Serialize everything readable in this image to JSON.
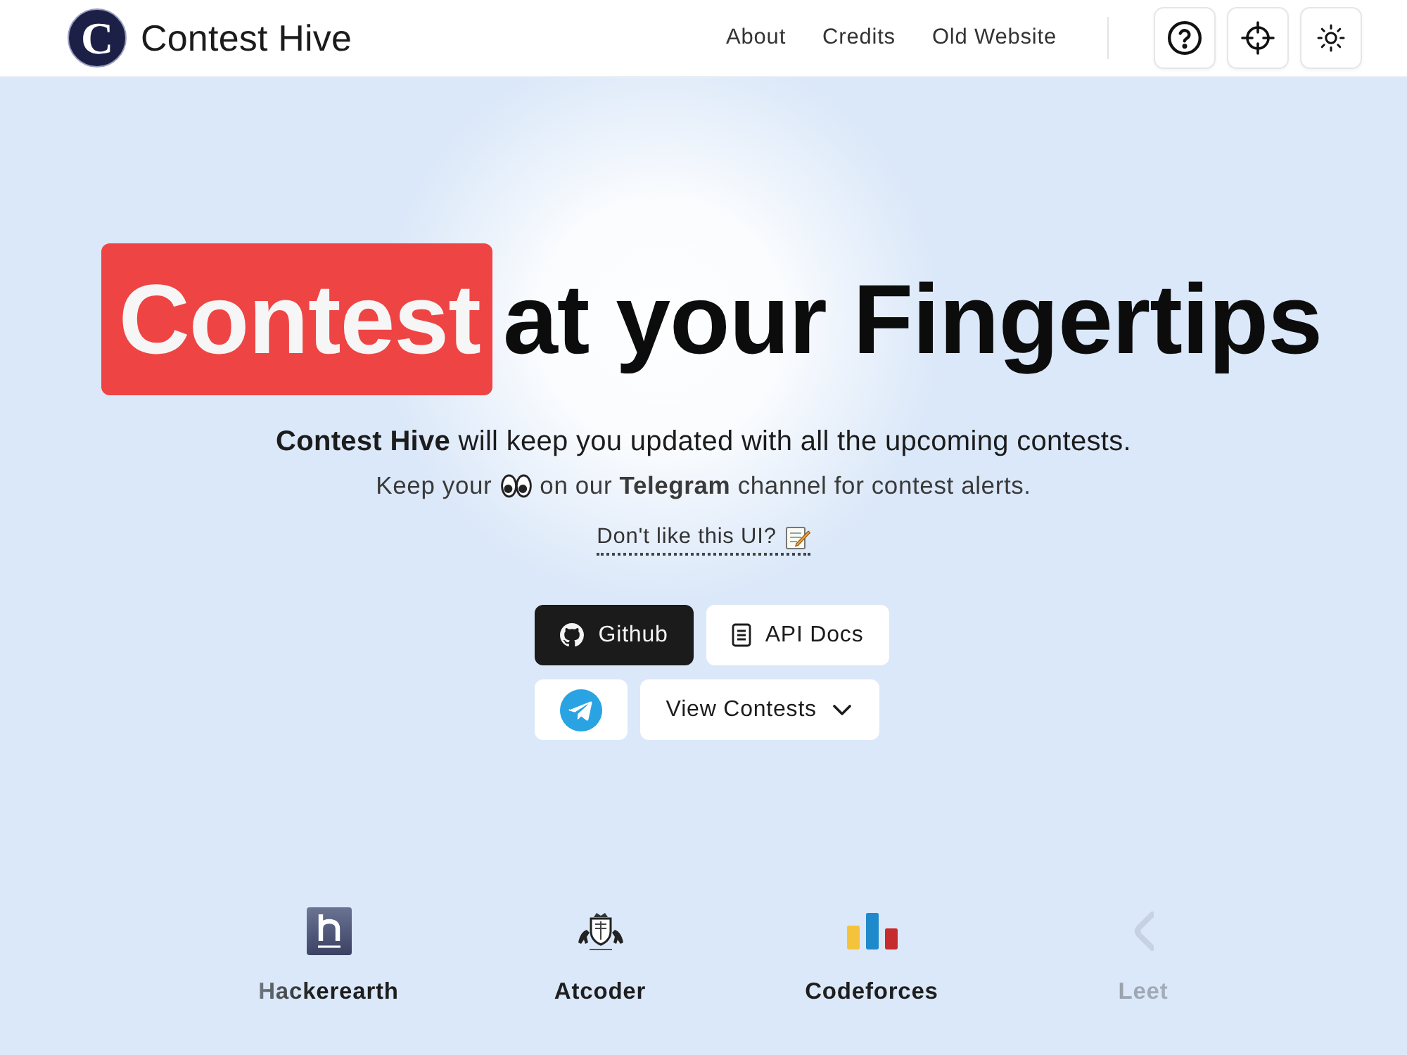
{
  "header": {
    "logo_mark": "C",
    "site_name": "Contest Hive",
    "nav_links": [
      "About",
      "Credits",
      "Old Website"
    ],
    "icon_buttons": [
      {
        "kind": "help"
      },
      {
        "kind": "locate"
      },
      {
        "kind": "theme"
      }
    ]
  },
  "hero": {
    "title_highlight": "Contest",
    "title_rest": "at your Fingertips",
    "tagline": "**Contest Hive** will keep you updated with all the upcoming contests.",
    "telegram_note": {
      "before": "Keep your",
      "after": "on our **Telegram** channel for contest alerts."
    },
    "feedback_link": "Don't like this UI?"
  },
  "button_rows": [
    [
      {
        "kind": "github",
        "label": "Github",
        "dark": true
      },
      {
        "kind": "docs",
        "label": "API Docs",
        "dark": false
      }
    ],
    [
      {
        "kind": "telegram",
        "dark": false
      },
      {
        "kind": "dropdown",
        "label": "View Contests",
        "dark": false
      }
    ]
  ],
  "platforms": [
    {
      "kind": "hackerearth",
      "name": "Hackerearth"
    },
    {
      "kind": "atcoder",
      "name": "Atcoder"
    },
    {
      "kind": "codeforces",
      "name": "Codeforces"
    },
    {
      "kind": "leetcode",
      "name": "Leet"
    }
  ]
}
